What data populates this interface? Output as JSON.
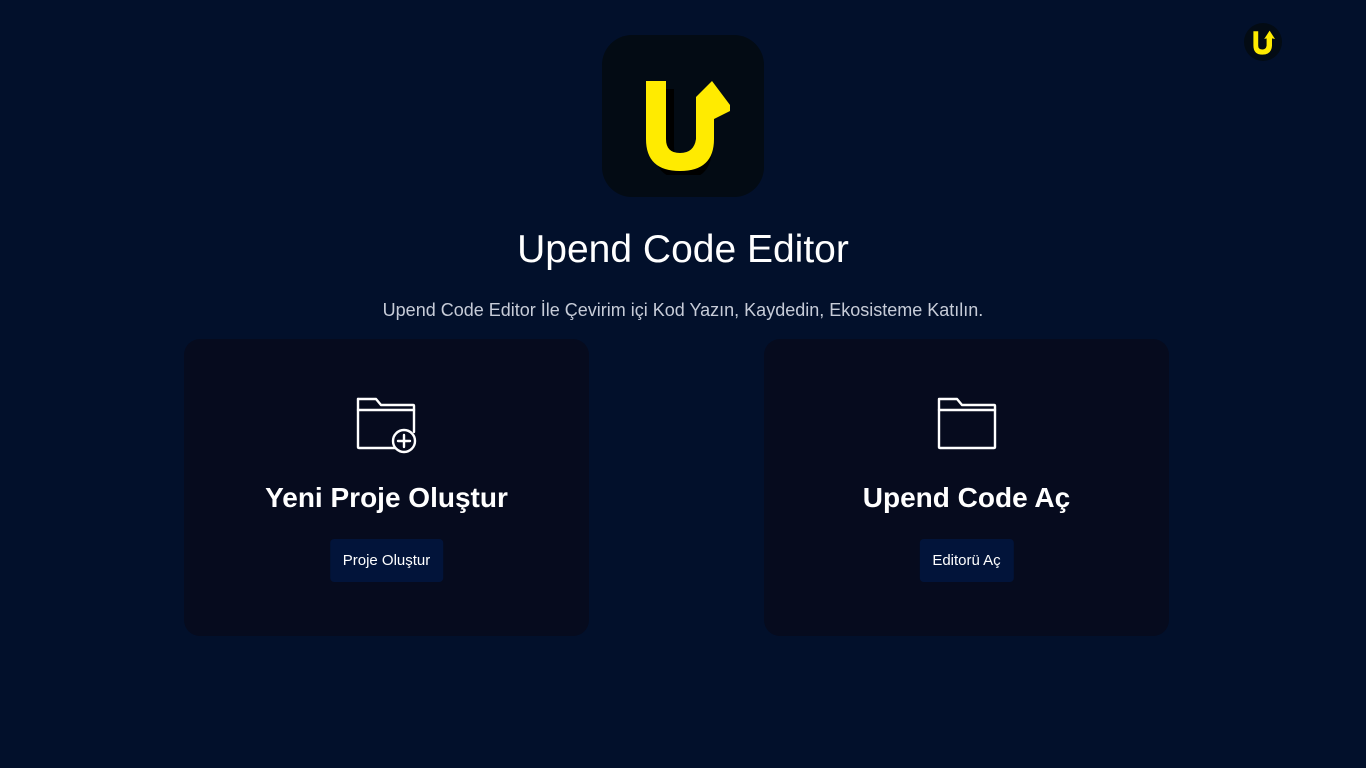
{
  "header": {
    "corner_logo_icon": "upend-logo-icon",
    "hero_logo_icon": "upend-logo-icon",
    "brand_color": "#ffeb00"
  },
  "main": {
    "title": "Upend Code Editor",
    "subtitle": "Upend Code Editor İle Çevirim içi Kod Yazın, Kaydedin, Ekosisteme Katılın."
  },
  "cards": [
    {
      "icon": "folder-plus-icon",
      "title": "Yeni Proje Oluştur",
      "button_label": "Proje Oluştur"
    },
    {
      "icon": "folder-icon",
      "title": "Upend Code Aç",
      "button_label": "Editorü Aç"
    }
  ],
  "colors": {
    "background": "#02102b",
    "card_background": "#060b1e",
    "button_background": "#02143a",
    "logo_background": "#030b14",
    "accent": "#ffeb00"
  }
}
